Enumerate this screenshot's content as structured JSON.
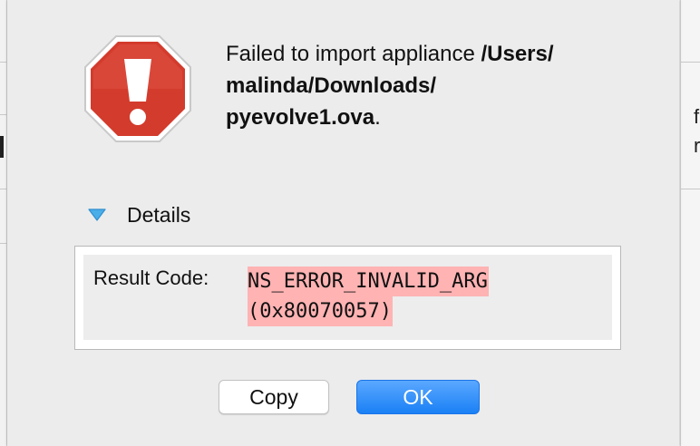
{
  "alert": {
    "message_prefix": "Failed to import appliance ",
    "path_line1": "/Users/",
    "path_line2": "malinda/Downloads/",
    "path_line3": "pyevolve1.ova",
    "message_suffix": "."
  },
  "icons": {
    "stop": "stop-icon",
    "disclosure": "disclosure-triangle-down-icon"
  },
  "details": {
    "label": "Details",
    "expanded": true,
    "result_code_label": "Result Code:",
    "result_code_value_line1": "NS_ERROR_INVALID_ARG",
    "result_code_value_line2": "(0x80070057)"
  },
  "buttons": {
    "copy_label": "Copy",
    "ok_label": "OK"
  },
  "colors": {
    "stop_red": "#d33b2c",
    "highlight": "#ffb3b3",
    "accent_blue": "#1a80f5",
    "disclosure_blue": "#4aaee8"
  },
  "background_window": {
    "right_glyph_1": "f",
    "right_glyph_2": "r"
  }
}
